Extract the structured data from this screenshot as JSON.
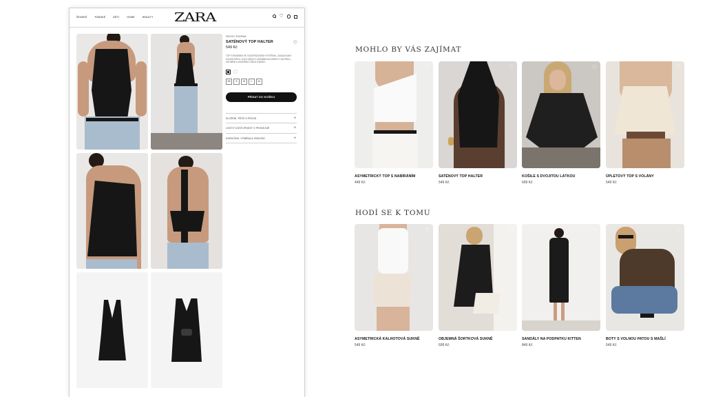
{
  "header": {
    "logo": "ZARA",
    "nav": [
      "ŽENSKÉ",
      "PÁNSKÉ",
      "DĚTI",
      "HOME",
      "BEAUTY"
    ],
    "icons": [
      "search-icon",
      "heart-icon",
      "user-icon",
      "bag-icon"
    ]
  },
  "product": {
    "category": "ZBOHO ZDARMA",
    "title": "SATÉNOVÝ TOP HALTER",
    "price": "549 Kč",
    "description": "TOP S ŘASENÍM VE VODOPÁDOVÉM VÝSTŘIHU, ZAVAZOVÁNÍ KOLEM KRKU, HOLÁ ZÁDA S VÁZÁNÍM NA ZÁDECH. NA KRKU, ZDOBENÍ A UZAVÍRACÍ ZÁDA S MAŠLÍ.",
    "colors": [
      "#111111",
      "#ffffff"
    ],
    "sizes": [
      "XS",
      "S",
      "M",
      "L",
      "XL"
    ],
    "add_button": "PŘIDAT DO KOŠÍKU",
    "accordion": [
      "SLOŽENÍ, PÉČE A PŮVOD",
      "ZJISTIT DOSTUPNOST V PRODEJNĚ",
      "DORUČENÍ, VÝMĚNA A VRÁCENÍ"
    ]
  },
  "recommend": {
    "title": "MOHLO BY VÁS ZAJÍMAT",
    "items": [
      {
        "name": "ASYMETRICKÝ TOP S NABÍRÁNÍM",
        "price": "449 Kč"
      },
      {
        "name": "SATÉNOVÝ TOP HALTER",
        "price": "549 Kč"
      },
      {
        "name": "KOŠILE S DVOJITOU LÁTKOU",
        "price": "699 Kč"
      },
      {
        "name": "ÚPLETOVÝ TOP S VOLÁNY",
        "price": "549 Kč"
      }
    ]
  },
  "matching": {
    "title": "HODÍ SE K TOMU",
    "items": [
      {
        "name": "ASYMETRICKÁ KALHOTOVÁ SUKNĚ",
        "price": "549 Kč"
      },
      {
        "name": "OBJEMNÁ ŠORTKOVÁ SUKNĚ",
        "price": "699 Kč"
      },
      {
        "name": "SANDÁLY NA PODPATKU KITTEN",
        "price": "849 Kč"
      },
      {
        "name": "BOTY S VOLNOU PATOU  S MAŠLÍ",
        "price": "549 Kč"
      }
    ]
  }
}
